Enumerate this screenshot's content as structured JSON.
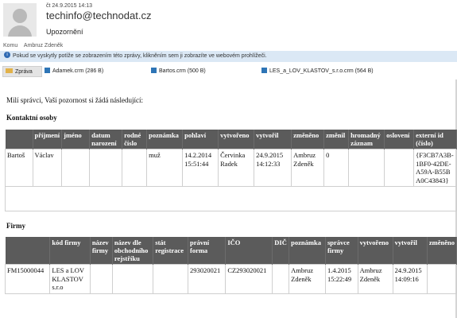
{
  "header": {
    "date": "čt 24.9.2015 14:13",
    "from": "techinfo@technodat.cz",
    "subject": "Upozornění",
    "recipients_label": "Komu",
    "recipient": "Ambruz Zdeněk"
  },
  "infobar": {
    "text": "Pokud se vyskytly potíže se zobrazením této zprávy, klikněním sem ji zobrazíte ve webovém prohlížeči."
  },
  "attachments": [
    {
      "label": "Zpráva"
    },
    {
      "label": "Adamek.crm (286 B)"
    },
    {
      "label": "Bartos.crm (500 B)"
    },
    {
      "label": "LES_a_LOV_KLASTOV_s.r.o.crm (564 B)"
    }
  ],
  "message": {
    "greeting": "Milí správci, Vaší pozornost si žádá následující:",
    "section1": "Kontaktní osoby",
    "section2": "Firmy"
  },
  "contacts": {
    "headers": [
      "",
      "příjmení",
      "jméno",
      "datum narození",
      "rodné číslo",
      "poznámka",
      "pohlaví",
      "vytvořeno",
      "vytvořil",
      "změněno",
      "změnil",
      "hromadný záznam",
      "oslovení",
      "externí id (číslo)"
    ],
    "rows": [
      [
        "Bartoš",
        "Václav",
        "",
        "",
        "",
        "muž",
        "14.2.2014 15:51:44",
        "Červinka Radek",
        "24.9.2015 14:12:33",
        "Ambruz Zdeněk",
        "0",
        "",
        "",
        "{F3CB7A3B-1BF0-42DE-A59A-B55BA0C43843}"
      ]
    ]
  },
  "companies": {
    "headers": [
      "",
      "kód firmy",
      "název firmy",
      "název dle obchodního rejstříku",
      "stát registrace",
      "právní forma",
      "IČO",
      "DIČ",
      "poznámka",
      "správce firmy",
      "vytvořeno",
      "vytvořil",
      "změněno"
    ],
    "rows": [
      [
        "FM15000044",
        "LES a LOV KLASTOV s.r.o",
        "",
        "",
        "",
        "293020021",
        "CZ293020021",
        "",
        "Ambruz Zdeněk",
        "1.4.2015 15:22:49",
        "Ambruz Zdeněk",
        "24.9.2015 14:09:16",
        ""
      ]
    ]
  }
}
